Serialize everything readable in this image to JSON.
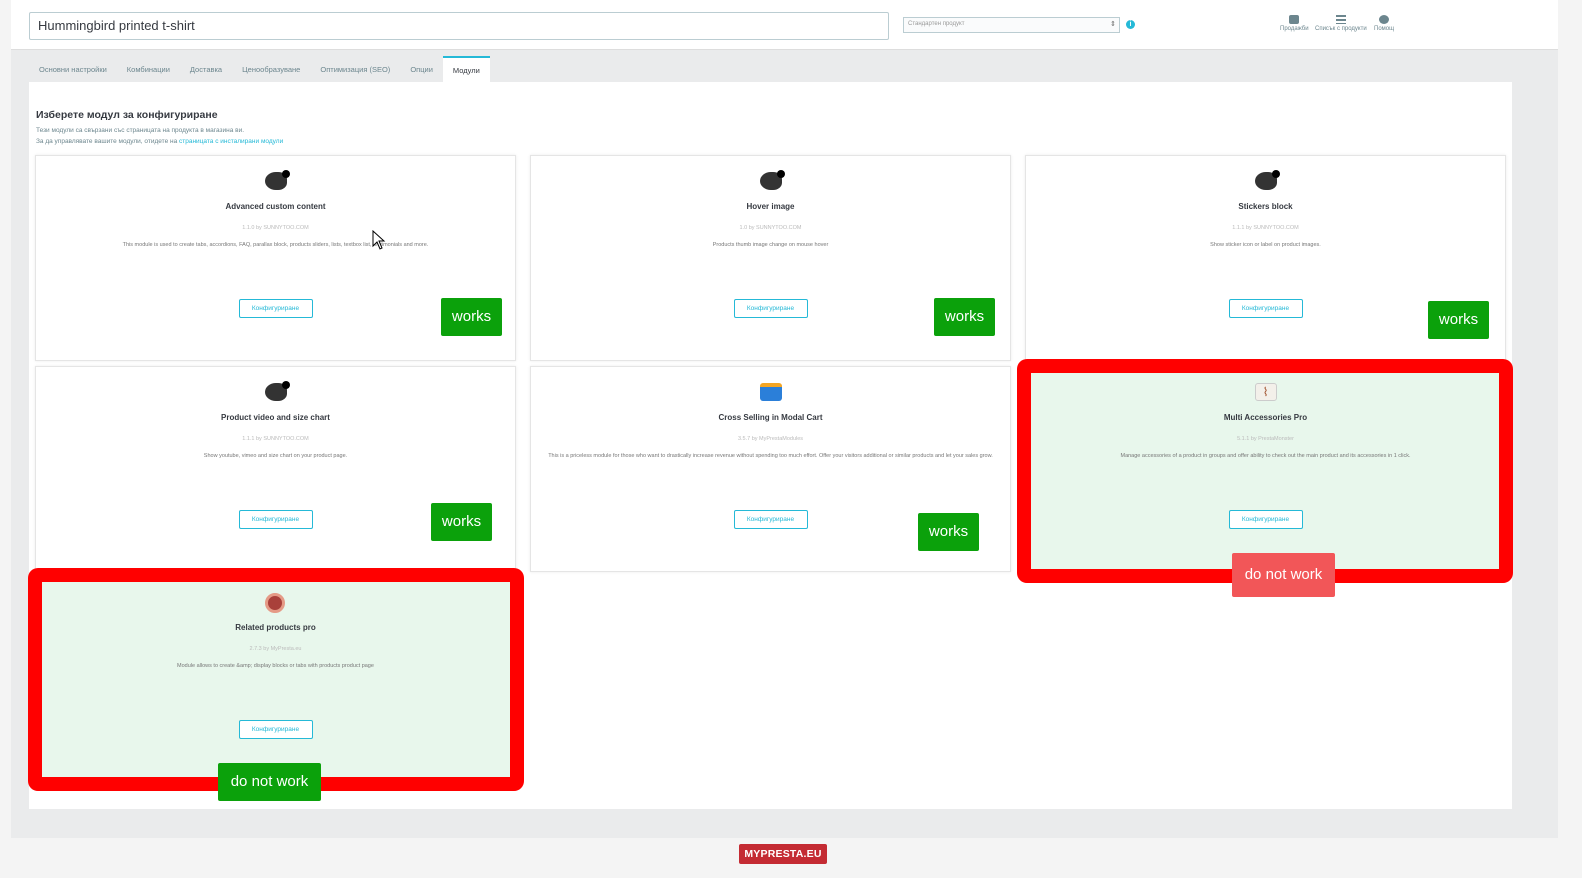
{
  "header": {
    "product_name": "Hummingbird printed t-shirt",
    "product_type": "Стандартен продукт",
    "tools": [
      {
        "label": "Продажби",
        "icon": "sales-icon"
      },
      {
        "label": "Списък с продукти",
        "icon": "list-icon"
      },
      {
        "label": "Помощ",
        "icon": "help-icon"
      }
    ]
  },
  "tabs": [
    "Основни настройки",
    "Комбинации",
    "Доставка",
    "Ценообразуване",
    "Оптимизация (SEO)",
    "Опции",
    "Модули"
  ],
  "active_tab": "Модули",
  "panel": {
    "title": "Изберете модул за конфигуриране",
    "desc1": "Тези модули са свързани със страницата на продукта в магазина ви.",
    "desc2_prefix": "За да управлявате вашите модули, отидете на ",
    "desc2_link": "страницата с инсталирани модули"
  },
  "modules": [
    {
      "title": "Advanced custom content",
      "version": "1.1.0 by SUNNYTOO.COM",
      "desc": "This module is used to create tabs, accordions, FAQ, parallax block, products sliders, lists, textbox list, testimonials and more.",
      "button": "Конфигуриране",
      "logo": "kiwi-logo-icon"
    },
    {
      "title": "Hover image",
      "version": "1.0 by SUNNYTOO.COM",
      "desc": "Products thumb image change on mouse hover",
      "button": "Конфигуриране",
      "logo": "kiwi-logo-icon"
    },
    {
      "title": "Stickers block",
      "version": "1.1.1 by SUNNYTOO.COM",
      "desc": "Show sticker icon or label on product images.",
      "button": "Конфигуриране",
      "logo": "kiwi-logo-icon"
    },
    {
      "title": "Product video and size chart",
      "version": "1.1.1 by SUNNYTOO.COM",
      "desc": "Show youtube, vimeo and size chart on your product page.",
      "button": "Конфигуриране",
      "logo": "kiwi-logo-icon"
    },
    {
      "title": "Cross Selling in Modal Cart",
      "version": "3.5.7 by MyPrestaModules",
      "desc": "This is a priceless module for those who want to drastically increase revenue without spending too much effort. Offer your visitors additional or similar products and let your sales grow.",
      "button": "Конфигуриране",
      "logo": "calendar-logo-icon"
    },
    {
      "title": "Multi Accessories Pro",
      "version": "5.1.1 by PrestaMonster",
      "desc": "Manage accessories of a product in groups and offer ability to check out the main product and its accessories in 1 click.",
      "button": "Конфигуриране",
      "logo": "paperclip-logo-icon"
    },
    {
      "title": "Related products pro",
      "version": "2.7.3 by MyPresta.eu",
      "desc": "Module allows to create &amp; display blocks or tabs with products product page",
      "button": "Конфигуриране",
      "logo": "related-products-logo-icon"
    }
  ],
  "annotations": {
    "works": "works",
    "do_not_work": "do not work"
  },
  "footer": {
    "brand": "MYPRESTA.EU"
  },
  "colors": {
    "accent": "#25b9d7",
    "works": "#0ba10b",
    "fail_red": "#ff0000",
    "fail_badge": "#f25658",
    "brand": "#c42b33"
  }
}
